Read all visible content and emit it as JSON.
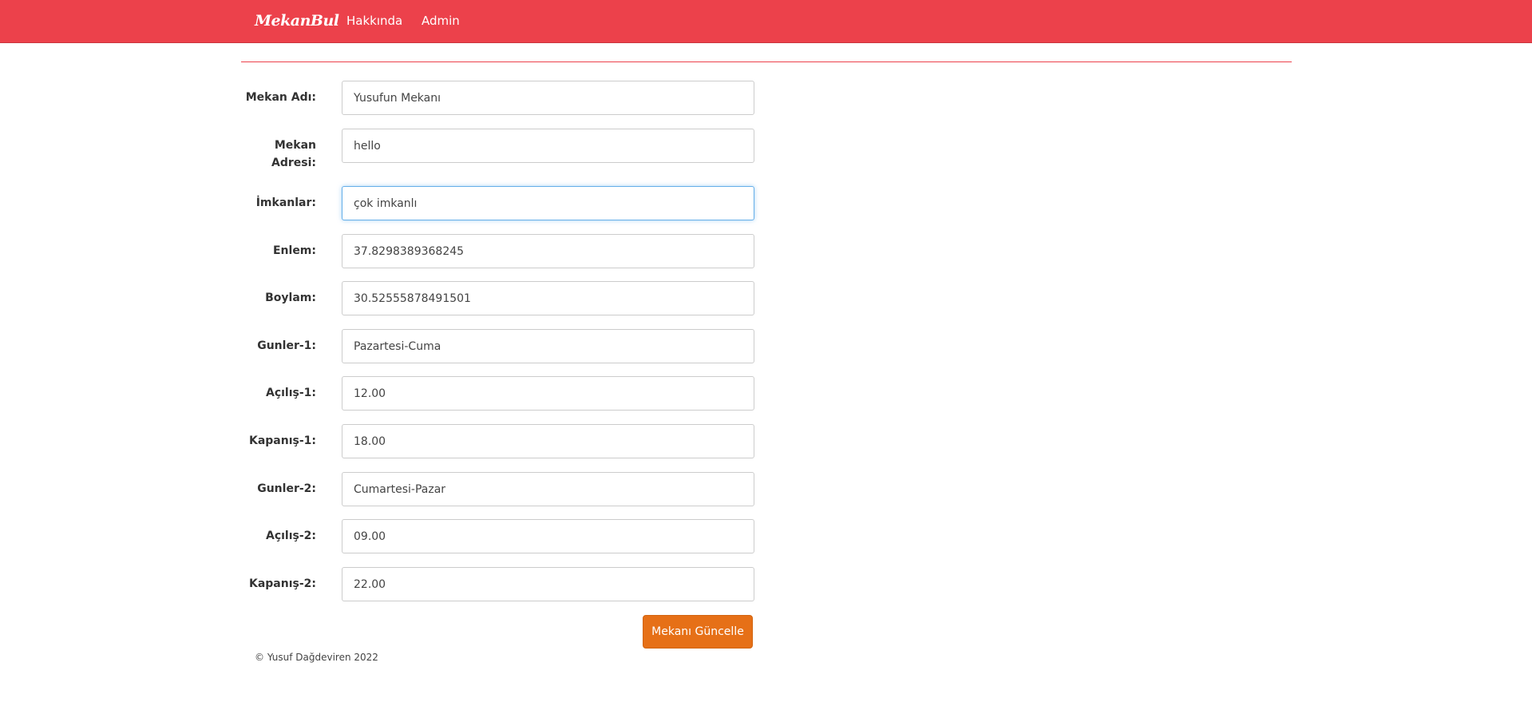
{
  "navbar": {
    "brand": "MekanBul",
    "links": [
      {
        "label": "Hakkında"
      },
      {
        "label": "Admin"
      }
    ]
  },
  "form": {
    "fields": [
      {
        "label": "Mekan Adı:",
        "value": "Yusufun Mekanı"
      },
      {
        "label": "Mekan Adresi:",
        "value": "hello"
      },
      {
        "label": "İmkanlar:",
        "value": "çok imkanlı"
      },
      {
        "label": "Enlem:",
        "value": "37.8298389368245"
      },
      {
        "label": "Boylam:",
        "value": "30.52555878491501"
      },
      {
        "label": "Gunler-1:",
        "value": "Pazartesi-Cuma"
      },
      {
        "label": "Açılış-1:",
        "value": "12.00"
      },
      {
        "label": "Kapanış-1:",
        "value": "18.00"
      },
      {
        "label": "Gunler-2:",
        "value": "Cumartesi-Pazar"
      },
      {
        "label": "Açılış-2:",
        "value": "09.00"
      },
      {
        "label": "Kapanış-2:",
        "value": "22.00"
      }
    ],
    "submit_label": "Mekanı Güncelle"
  },
  "footer": {
    "copyright": "© Yusuf Dağdeviren 2022"
  },
  "colors": {
    "navbar_bg": "#ec414b",
    "button_bg": "#e67017",
    "focus_border": "#66afe9"
  }
}
